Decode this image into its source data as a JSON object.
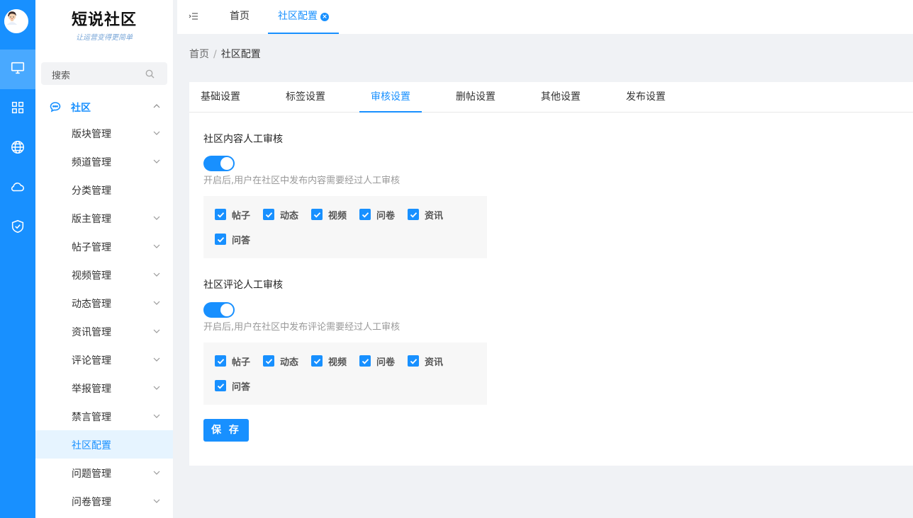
{
  "brand": {
    "title": "短说社区",
    "subtitle": "让运营变得更简单"
  },
  "rail": {
    "icons": [
      "monitor-icon",
      "grid-icon",
      "globe-icon",
      "cloud-icon",
      "shield-check-icon"
    ]
  },
  "sidebar": {
    "search_placeholder": "搜索",
    "parent": {
      "label": "社区"
    },
    "items": [
      {
        "label": "版块管理",
        "arrow": true
      },
      {
        "label": "频道管理",
        "arrow": true
      },
      {
        "label": "分类管理",
        "arrow": false
      },
      {
        "label": "版主管理",
        "arrow": true
      },
      {
        "label": "帖子管理",
        "arrow": true
      },
      {
        "label": "视频管理",
        "arrow": true
      },
      {
        "label": "动态管理",
        "arrow": true
      },
      {
        "label": "资讯管理",
        "arrow": true
      },
      {
        "label": "评论管理",
        "arrow": true
      },
      {
        "label": "举报管理",
        "arrow": true
      },
      {
        "label": "禁言管理",
        "arrow": true
      },
      {
        "label": "社区配置",
        "arrow": false,
        "active": true
      },
      {
        "label": "问题管理",
        "arrow": true
      },
      {
        "label": "问卷管理",
        "arrow": true
      }
    ]
  },
  "topbar": {
    "tabs": [
      {
        "label": "首页"
      },
      {
        "label": "社区配置",
        "active": true
      }
    ]
  },
  "breadcrumb": {
    "home": "首页",
    "separator": "/",
    "current": "社区配置"
  },
  "tabs": [
    {
      "label": "基础设置"
    },
    {
      "label": "标签设置"
    },
    {
      "label": "审核设置",
      "active": true
    },
    {
      "label": "删帖设置"
    },
    {
      "label": "其他设置"
    },
    {
      "label": "发布设置"
    }
  ],
  "content_review": {
    "title": "社区内容人工审核",
    "enabled": true,
    "hint": "开启后,用户在社区中发布内容需要经过人工审核",
    "options": [
      {
        "label": "帖子",
        "checked": true
      },
      {
        "label": "动态",
        "checked": true
      },
      {
        "label": "视频",
        "checked": true
      },
      {
        "label": "问卷",
        "checked": true
      },
      {
        "label": "资讯",
        "checked": true
      },
      {
        "label": "问答",
        "checked": true
      }
    ]
  },
  "comment_review": {
    "title": "社区评论人工审核",
    "enabled": true,
    "hint": "开启后,用户在社区中发布评论需要经过人工审核",
    "options": [
      {
        "label": "帖子",
        "checked": true
      },
      {
        "label": "动态",
        "checked": true
      },
      {
        "label": "视频",
        "checked": true
      },
      {
        "label": "问卷",
        "checked": true
      },
      {
        "label": "资讯",
        "checked": true
      },
      {
        "label": "问答",
        "checked": true
      }
    ]
  },
  "save_button": "保 存",
  "colors": {
    "primary": "#1890ff",
    "rail_active": "#49a9ff",
    "menu_active_bg": "#e6f4ff",
    "page_bg": "#f0f2f5"
  }
}
